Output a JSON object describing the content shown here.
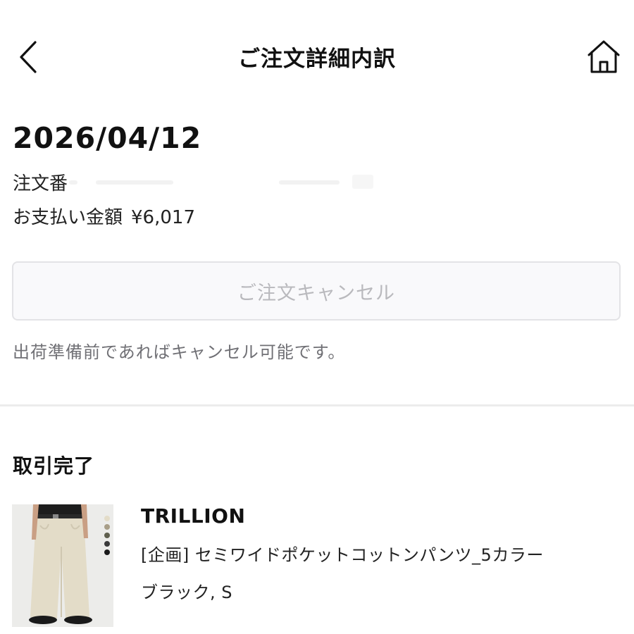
{
  "header": {
    "title": "ご注文詳細内訳",
    "back_icon": "chevron-left-icon",
    "home_icon": "home-icon"
  },
  "order": {
    "date": "2026/04/12",
    "number_label": "注文番",
    "payment_label": "お支払い金額",
    "payment_amount": "¥6,017"
  },
  "cancel": {
    "button_label": "ご注文キャンセル",
    "note": "出荷準備前であればキャンセル可能です。"
  },
  "transaction": {
    "status": "取引完了",
    "item": {
      "brand": "TRILLION",
      "name": "[企画] セミワイドポケットコットンパンツ_5カラー",
      "variant": "ブラック, S"
    }
  },
  "colors": {
    "cancel_text": "#b9b9bd",
    "cancel_border": "#e3e3e6",
    "note_text": "#707075",
    "divider": "#ececec"
  }
}
